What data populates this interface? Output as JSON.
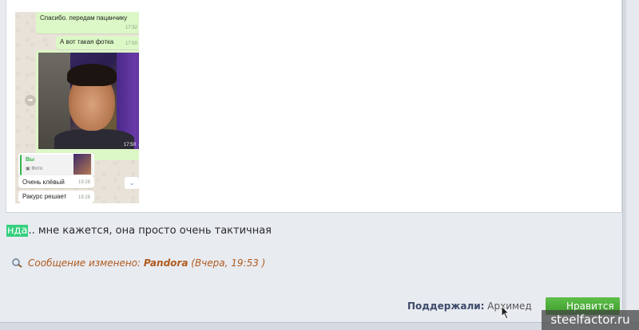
{
  "chat": {
    "msg1": "Спасибо. передам пацанчику",
    "msg1_time": "17:32",
    "msg2": "А вот такая фотка",
    "msg2_time": "17:50",
    "photo_time": "17:50",
    "reply_name": "Вы",
    "reply_sub": "Фото",
    "in1": "Очень клёвый",
    "in1_time": "19:28",
    "in2": "Ракурс решает",
    "in2_time": "19:28"
  },
  "post": {
    "highlight": "нда",
    "text": ".. мне кажется, она просто очень тактичная"
  },
  "edit": {
    "label": "Сообщение изменено:",
    "author": "Pandora",
    "time": "(Вчера, 19:53 )"
  },
  "thanks": {
    "label": "Поддержали:",
    "users": "Архимед"
  },
  "like_button": "Нравится",
  "watermark": "steelfactor.ru",
  "colors": {
    "accent_green": "#35d07f",
    "edit_text": "#b05a1e",
    "button_green": "#4aac38"
  }
}
